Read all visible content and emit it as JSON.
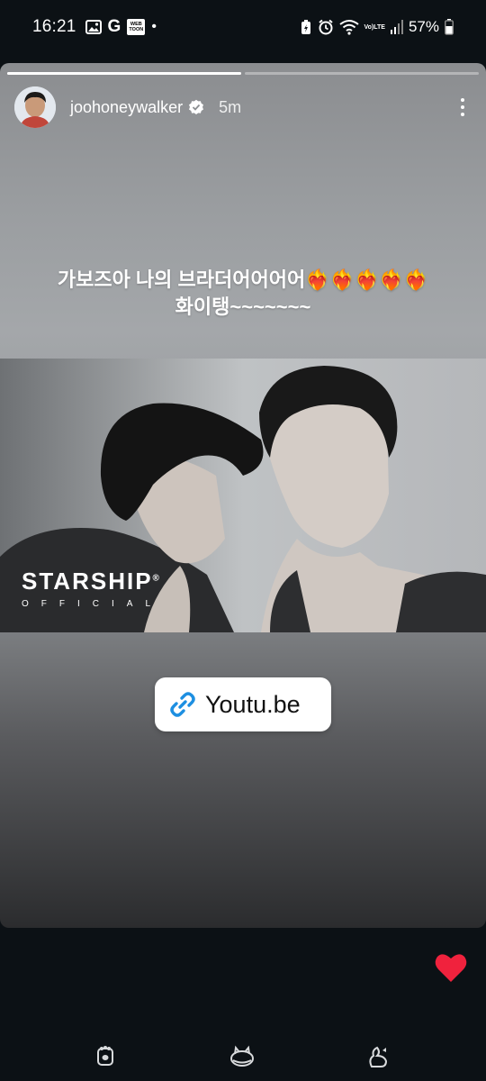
{
  "status_bar": {
    "time": "16:21",
    "left_icons": [
      "gallery-icon",
      "google-icon",
      "webtoon-icon",
      "notification-dot-icon"
    ],
    "webtoon_line1": "WEB",
    "webtoon_line2": "TOON",
    "google_letter": "G",
    "dot": "•",
    "volte_line1": "Vo)",
    "volte_line2": "LTE",
    "battery_percent": "57%"
  },
  "story": {
    "progress": [
      1.0,
      0.0
    ],
    "progress_current_fraction": 1.0,
    "username": "joohoneywalker",
    "verified": true,
    "time_ago": "5m",
    "caption_line1": "가보즈아 나의 브라더어어어어❤️‍🔥❤️‍🔥❤️‍🔥❤️‍🔥❤️‍🔥",
    "caption_line2": "화이탱~~~~~~~",
    "photo_logo": "STARSHIP",
    "photo_logo_sub": "OFFICIAL",
    "photo_logo_mark": "®",
    "link_sticker_text": "Youtu.be",
    "liked": true,
    "colors": {
      "like": "#f0223d",
      "link_icon": "#1d8fe1"
    }
  },
  "nav_bar": {
    "buttons": [
      "recents-icon",
      "home-icon",
      "back-icon"
    ]
  }
}
